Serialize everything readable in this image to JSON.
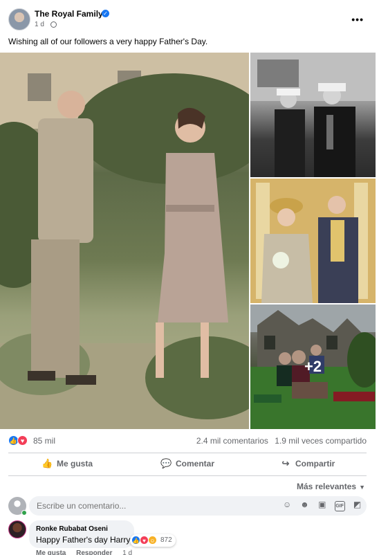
{
  "post": {
    "page_name": "The Royal Family",
    "time": "1 d",
    "caption": "Wishing all of our followers a very happy Father's Day.",
    "extra_photos": "+2"
  },
  "icons": {
    "verified": "verified-badge-icon",
    "privacy": "globe-icon",
    "more": "more-options-icon"
  },
  "engagement": {
    "reactions_count": "85 mil",
    "comments": "2.4 mil comentarios",
    "shares": "1.9 mil veces compartido"
  },
  "actions": {
    "like": "Me gusta",
    "comment": "Comentar",
    "share": "Compartir"
  },
  "sort": {
    "label": "Más relevantes"
  },
  "composer": {
    "placeholder": "Escribe un comentario..."
  },
  "comments": [
    {
      "author": "Ronke Rubabat Oseni",
      "text": "Happy Father's day Harry",
      "reaction_count": "872",
      "like_label": "Me gusta",
      "reply_label": "Responder",
      "time": "1 d"
    }
  ],
  "colors": {
    "accent": "#1877f2",
    "love": "#f33e58",
    "online": "#31a24c"
  }
}
